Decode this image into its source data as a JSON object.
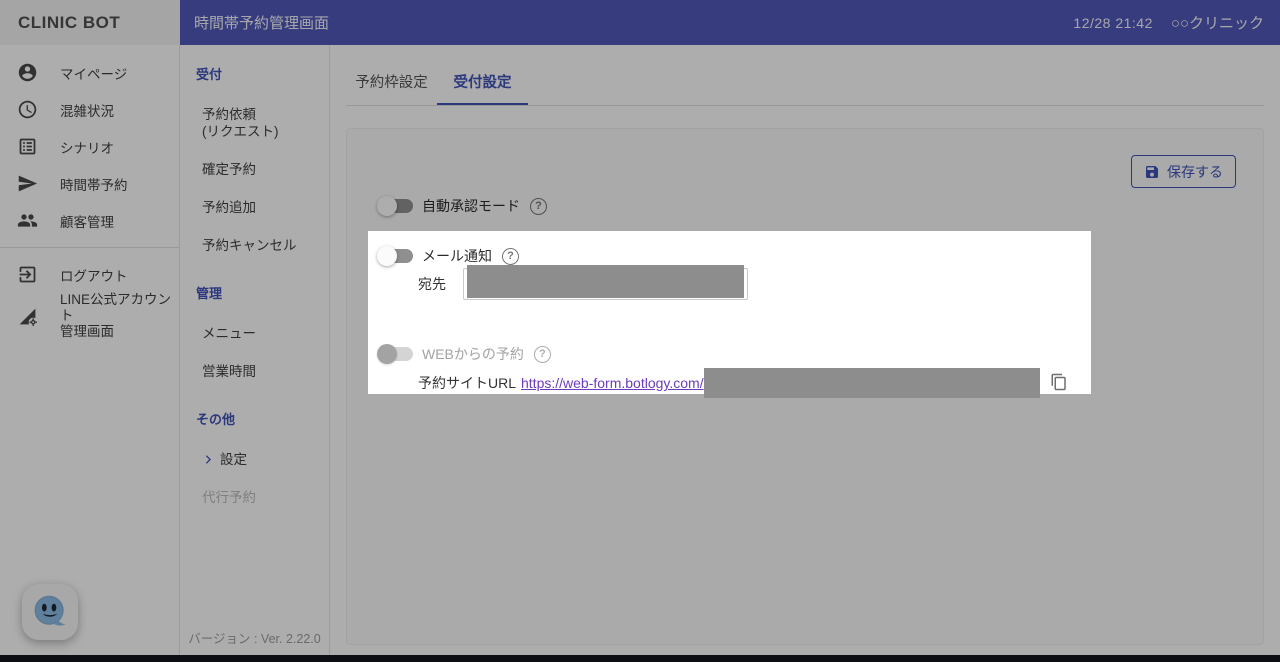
{
  "colors": {
    "accent": "#3f51b5",
    "topbar": "#5058b8",
    "link_purple": "#6d3bba",
    "redaction_gray": "#8d8d8d"
  },
  "logo": {
    "text": "CLINIC BOT"
  },
  "topbar": {
    "title": "時間帯予約管理画面",
    "datetime": "12/28 21:42",
    "account": "○○クリニック"
  },
  "sidebar": {
    "items": [
      {
        "icon": "user-icon",
        "label": "マイページ"
      },
      {
        "icon": "clock-icon",
        "label": "混雑状況"
      },
      {
        "icon": "scenario-icon",
        "label": "シナリオ"
      },
      {
        "icon": "send-icon",
        "label": "時間帯予約"
      },
      {
        "icon": "customers-icon",
        "label": "顧客管理"
      }
    ],
    "footer_items": [
      {
        "icon": "logout-icon",
        "label": "ログアウト"
      },
      {
        "icon": "line-settings-icon",
        "label": "LINE公式アカウント",
        "label2": "管理画面"
      }
    ]
  },
  "submenu": {
    "sections": [
      {
        "title": "受付",
        "items": [
          {
            "label": "予約依頼",
            "label2": "(リクエスト)"
          },
          {
            "label": "確定予約"
          },
          {
            "label": "予約追加"
          },
          {
            "label": "予約キャンセル"
          }
        ]
      },
      {
        "title": "管理",
        "items": [
          {
            "label": "メニュー"
          },
          {
            "label": "営業時間"
          }
        ]
      },
      {
        "title": "その他",
        "items": [
          {
            "label": "設定"
          },
          {
            "label": "代行予約",
            "disabled": true
          }
        ]
      }
    ],
    "version": "バージョン : Ver. 2.22.0"
  },
  "tabs": [
    {
      "label": "予約枠設定",
      "active": false
    },
    {
      "label": "受付設定",
      "active": true
    }
  ],
  "panel": {
    "save_button": "保存する",
    "auto_approve_label": "自動承認モード",
    "auto_approve_enabled": false,
    "mail_notify_label": "メール通知",
    "mail_notify_enabled": false,
    "recipient_label": "宛先",
    "recipient_redacted": true,
    "web_booking_label": "WEBからの予約",
    "web_booking_enabled": false,
    "url_label": "予約サイトURL",
    "url_text": "https://web-form.botlogy.com/",
    "url_redacted": true
  }
}
